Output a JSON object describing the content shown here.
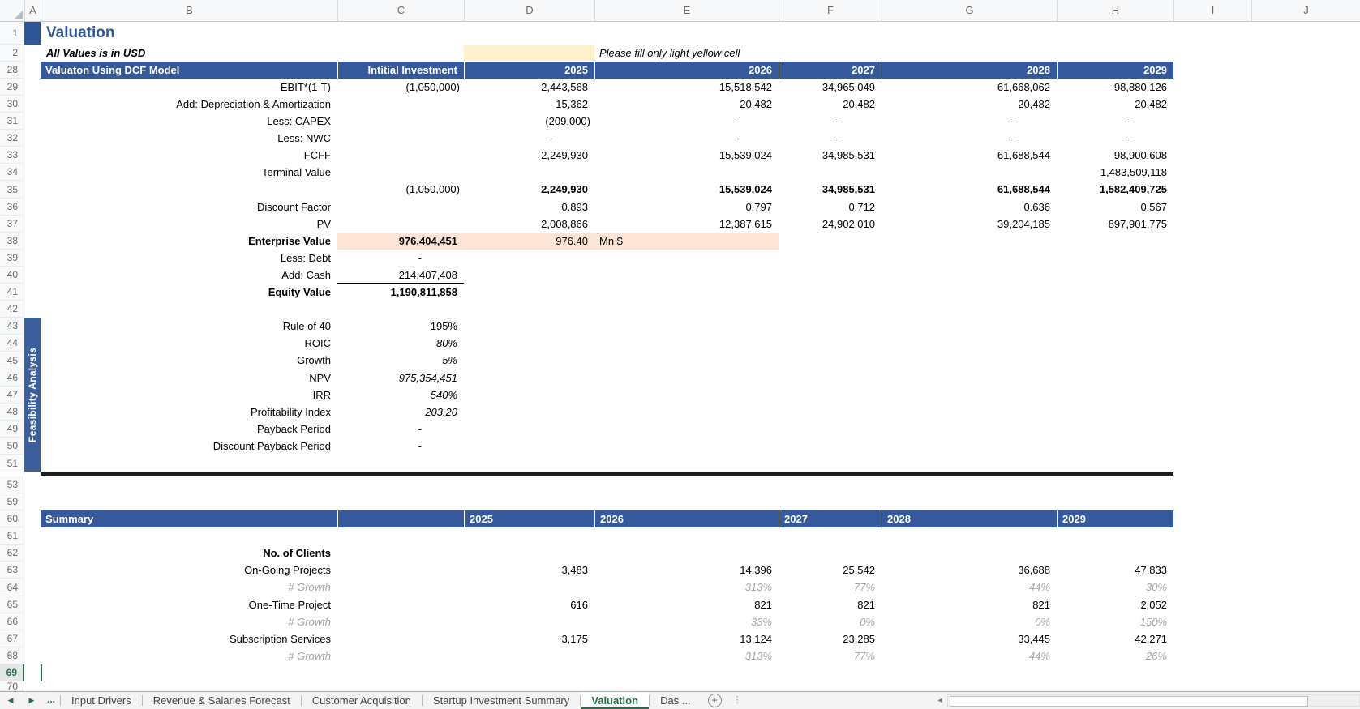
{
  "colors": {
    "band_blue": "#35599B",
    "title_blue": "#2E5596",
    "feasibility_tab_blue": "#3D5E9C",
    "highlight_peach": "#FCE4D6",
    "input_yellow": "#FDF0CD",
    "growth_gray": "#A6A6A6",
    "active_tab_green": "#217346"
  },
  "sheet": {
    "title": "Valuation",
    "subtitle": "All Values is in USD",
    "note": "Please fill only light yellow cell",
    "column_headers": [
      "A",
      "B",
      "C",
      "D",
      "E",
      "F",
      "G",
      "H",
      "I",
      "J"
    ],
    "row_numbers": [
      1,
      2,
      28,
      29,
      30,
      31,
      32,
      33,
      34,
      35,
      36,
      37,
      38,
      39,
      40,
      41,
      42,
      43,
      44,
      45,
      46,
      47,
      48,
      49,
      50,
      51,
      53,
      59,
      60,
      61,
      62,
      63,
      64,
      65,
      66,
      67,
      68,
      69,
      70
    ],
    "selected_row": 69
  },
  "years": [
    "2025",
    "2026",
    "2027",
    "2028",
    "2029"
  ],
  "dcf": {
    "header": {
      "title": "Valuaton Using DCF Model",
      "investment_label": "Intitial Investment"
    },
    "rows": [
      {
        "row": 29,
        "label": "EBIT*(1-T)",
        "c": "(1,050,000)",
        "values": [
          "2,443,568",
          "15,518,542",
          "34,965,049",
          "61,668,062",
          "98,880,126"
        ]
      },
      {
        "row": 30,
        "label": "Add: Depreciation & Amortization",
        "c": "",
        "values": [
          "15,362",
          "20,482",
          "20,482",
          "20,482",
          "20,482"
        ]
      },
      {
        "row": 31,
        "label": "Less: CAPEX",
        "c": "",
        "values": [
          "(209,000)",
          "-",
          "-",
          "-",
          "-"
        ]
      },
      {
        "row": 32,
        "label": "Less: NWC",
        "c": "",
        "values": [
          "-",
          "-",
          "-",
          "-",
          "-"
        ]
      },
      {
        "row": 33,
        "label": "FCFF",
        "c": "",
        "values": [
          "2,249,930",
          "15,539,024",
          "34,985,531",
          "61,688,544",
          "98,900,608"
        ]
      },
      {
        "row": 34,
        "label": "Terminal Value",
        "c": "",
        "values": [
          "",
          "",
          "",
          "",
          "1,483,509,118"
        ]
      },
      {
        "row": 35,
        "label": "",
        "c": "(1,050,000)",
        "values": [
          "2,249,930",
          "15,539,024",
          "34,985,531",
          "61,688,544",
          "1,582,409,725"
        ],
        "values_bold": true
      },
      {
        "row": 36,
        "label": "Discount Factor",
        "c": "",
        "values": [
          "0.893",
          "0.797",
          "0.712",
          "0.636",
          "0.567"
        ]
      },
      {
        "row": 37,
        "label": "PV",
        "c": "",
        "values": [
          "2,008,866",
          "12,387,615",
          "24,902,010",
          "39,204,185",
          "897,901,775"
        ]
      },
      {
        "row": 38,
        "label": "Enterprise Value",
        "label_bold": true,
        "c": "976,404,451",
        "c_bold": true,
        "d": "976.40",
        "e_label": "Mn $",
        "highlight": true,
        "values": [
          "",
          "",
          "",
          "",
          ""
        ]
      },
      {
        "row": 39,
        "label": "Less: Debt",
        "c": "-",
        "values": [
          "",
          "",
          "",
          "",
          ""
        ]
      },
      {
        "row": 40,
        "label": "Add: Cash",
        "c": "214,407,408",
        "c_underline": true,
        "values": [
          "",
          "",
          "",
          "",
          ""
        ]
      },
      {
        "row": 41,
        "label": "Equity Value",
        "label_bold": true,
        "c": "1,190,811,858",
        "c_bold": true,
        "values": [
          "",
          "",
          "",
          "",
          ""
        ]
      }
    ]
  },
  "feasibility": {
    "tab_label": "Feasibility Analysis",
    "rows": [
      {
        "row": 43,
        "label": "Rule of 40",
        "value": "195%",
        "italic": false
      },
      {
        "row": 44,
        "label": "ROIC",
        "value": "80%",
        "italic": true
      },
      {
        "row": 45,
        "label": "Growth",
        "value": "5%",
        "italic": true
      },
      {
        "row": 46,
        "label": "NPV",
        "value": "975,354,451",
        "italic": true
      },
      {
        "row": 47,
        "label": "IRR",
        "value": "540%",
        "italic": true
      },
      {
        "row": 48,
        "label": "Profitability Index",
        "value": "203.20",
        "italic": true
      },
      {
        "row": 49,
        "label": "Payback Period",
        "value": "-",
        "italic": false
      },
      {
        "row": 50,
        "label": "Discount Payback Period",
        "value": "-",
        "italic": false
      }
    ]
  },
  "summary": {
    "title": "Summary",
    "rows": [
      {
        "row": 62,
        "label": "No. of Clients",
        "label_bold": true,
        "values": [
          "",
          "",
          "",
          "",
          ""
        ]
      },
      {
        "row": 63,
        "label": "On-Going Projects",
        "values": [
          "3,483",
          "14,396",
          "25,542",
          "36,688",
          "47,833"
        ]
      },
      {
        "row": 64,
        "label": "# Growth",
        "growth": true,
        "values": [
          "",
          "313%",
          "77%",
          "44%",
          "30%"
        ]
      },
      {
        "row": 65,
        "label": "One-Time Project",
        "values": [
          "616",
          "821",
          "821",
          "821",
          "2,052"
        ]
      },
      {
        "row": 66,
        "label": "# Growth",
        "growth": true,
        "values": [
          "",
          "33%",
          "0%",
          "0%",
          "150%"
        ]
      },
      {
        "row": 67,
        "label": "Subscription Services",
        "values": [
          "3,175",
          "13,124",
          "23,285",
          "33,445",
          "42,271"
        ]
      },
      {
        "row": 68,
        "label": "# Growth",
        "growth": true,
        "values": [
          "",
          "313%",
          "77%",
          "44%",
          "26%"
        ]
      }
    ]
  },
  "tab_bar": {
    "nav_left": "◀",
    "nav_right": "▶",
    "more": "...",
    "sheets": [
      {
        "label": "Input Drivers",
        "active": false
      },
      {
        "label": "Revenue & Salaries Forecast",
        "active": false
      },
      {
        "label": "Customer Acquisition",
        "active": false
      },
      {
        "label": "Startup Investment Summary",
        "active": false
      },
      {
        "label": "Valuation",
        "active": true
      },
      {
        "label": "Das ...",
        "active": false
      }
    ],
    "add_sheet": "+",
    "scroll_left": "◄"
  }
}
